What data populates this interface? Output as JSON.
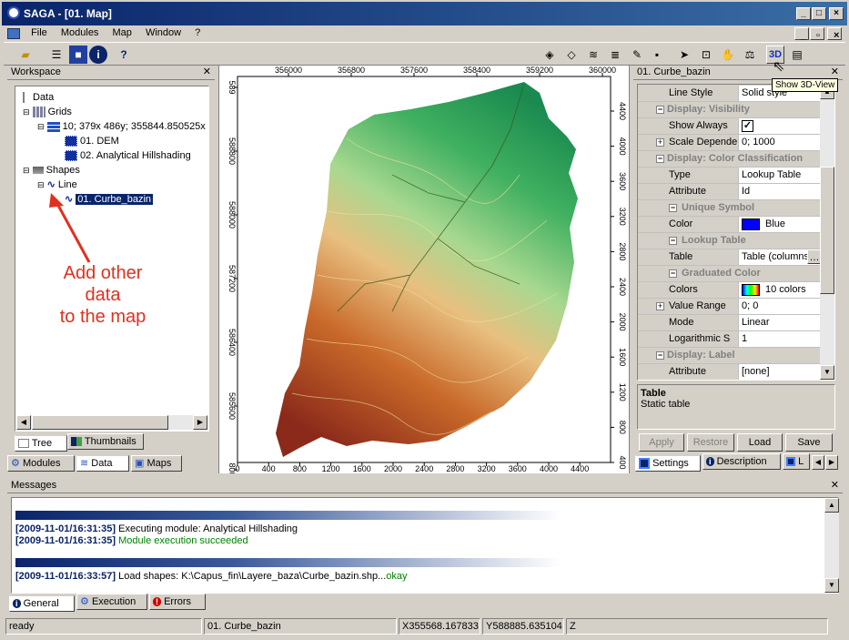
{
  "window": {
    "title": "SAGA - [01. Map]"
  },
  "menu": [
    "File",
    "Modules",
    "Map",
    "Window",
    "?"
  ],
  "tooltip": "Show 3D-View",
  "workspace": {
    "title": "Workspace",
    "tree": [
      {
        "label": "Data",
        "indent": 0
      },
      {
        "label": "Grids",
        "indent": 1
      },
      {
        "label": "10; 379x 486y; 355844.850525x",
        "indent": 2
      },
      {
        "label": "01. DEM",
        "indent": 3
      },
      {
        "label": "02. Analytical Hillshading",
        "indent": 3
      },
      {
        "label": "Shapes",
        "indent": 1
      },
      {
        "label": "Line",
        "indent": 2
      },
      {
        "label": "01. Curbe_bazin",
        "indent": 3
      }
    ],
    "tabs_view": [
      "Tree",
      "Thumbnails"
    ],
    "tabs_bottom": [
      "Modules",
      "Data",
      "Maps"
    ]
  },
  "annotation": {
    "line1": "Add other",
    "line2": "data",
    "line3": "to the map",
    "color": "#e03020"
  },
  "map": {
    "x_ticks_top": [
      "356000",
      "356800",
      "357600",
      "358400",
      "359200",
      "360000"
    ],
    "x_ticks_bottom": [
      "0",
      "400",
      "800",
      "1200",
      "1600",
      "2000",
      "2400",
      "2800",
      "3200",
      "3600",
      "4000",
      "4400"
    ],
    "y_ticks_left": [
      "589",
      "588800",
      "588000",
      "587200",
      "586400",
      "585600",
      "800"
    ],
    "y_ticks_right": [
      "4400",
      "4000",
      "3600",
      "3200",
      "2800",
      "2400",
      "2000",
      "1600",
      "1200",
      "800",
      "400"
    ]
  },
  "props": {
    "title": "01. Curbe_bazin",
    "rows": [
      {
        "type": "prop",
        "key": "Line Style",
        "value": "Solid style"
      },
      {
        "type": "cat",
        "key": "Display: Visibility"
      },
      {
        "type": "prop",
        "key": "Show Always",
        "value": "✓"
      },
      {
        "type": "prop",
        "key": "Scale Depender",
        "value": "0; 1000",
        "expand": true
      },
      {
        "type": "cat",
        "key": "Display: Color Classification"
      },
      {
        "type": "prop",
        "key": "Type",
        "value": "Lookup Table"
      },
      {
        "type": "prop",
        "key": "Attribute",
        "value": "Id"
      },
      {
        "type": "sub",
        "key": "Unique Symbol"
      },
      {
        "type": "prop",
        "key": "Color",
        "value": "Blue",
        "swatch": "#0000ff"
      },
      {
        "type": "sub",
        "key": "Lookup Table"
      },
      {
        "type": "prop",
        "key": "Table",
        "value": "Table (columns",
        "dots": true
      },
      {
        "type": "sub",
        "key": "Graduated Color"
      },
      {
        "type": "prop",
        "key": "Colors",
        "value": "10 colors",
        "ramp": true
      },
      {
        "type": "prop",
        "key": "Value Range",
        "value": "0; 0",
        "expand": true
      },
      {
        "type": "prop",
        "key": "Mode",
        "value": "Linear"
      },
      {
        "type": "prop",
        "key": "Logarithmic S",
        "value": "1"
      },
      {
        "type": "cat",
        "key": "Display: Label"
      },
      {
        "type": "prop",
        "key": "Attribute",
        "value": "[none]"
      }
    ],
    "desc_title": "Table",
    "desc_text": "Static table",
    "buttons": [
      "Apply",
      "Restore",
      "Load",
      "Save"
    ],
    "tabs": [
      "Settings",
      "Description",
      "L"
    ]
  },
  "messages": {
    "title": "Messages",
    "lines": [
      {
        "ts": "[2009-11-01/16:31:35]",
        "text": " Executing module: Analytical Hillshading",
        "color": "#000000"
      },
      {
        "ts": "[2009-11-01/16:31:35]",
        "text": " Module execution succeeded",
        "color": "#008000"
      },
      {
        "ts": "[2009-11-01/16:33:57]",
        "text": " Load shapes: K:\\Capus_fin\\Layere_baza\\Curbe_bazin.shp...",
        "color": "#000000",
        "ok": "okay"
      }
    ],
    "tabs": [
      "General",
      "Execution",
      "Errors"
    ]
  },
  "status": {
    "ready": "ready",
    "layer": "01. Curbe_bazin",
    "x": "X355568.167833",
    "y": "Y588885.635104",
    "z": "Z"
  }
}
